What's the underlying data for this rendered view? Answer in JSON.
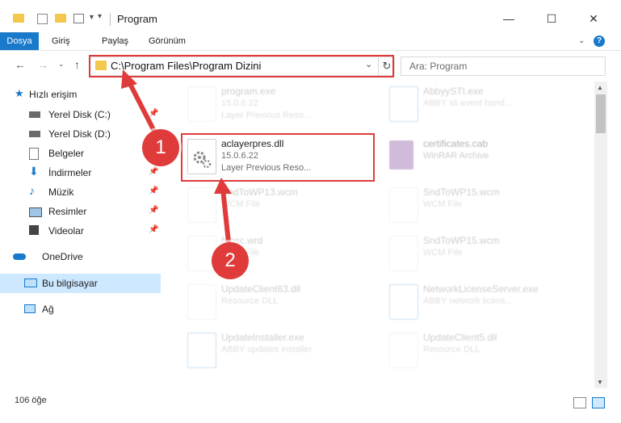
{
  "window": {
    "title": "Program"
  },
  "ribbon": {
    "tabs": [
      "Dosya",
      "Giriş",
      "Paylaş",
      "Görünüm"
    ],
    "help": "?"
  },
  "address": {
    "path": "C:\\Program Files\\Program Dizini"
  },
  "search": {
    "placeholder": "Ara: Program"
  },
  "sidebar": {
    "quick_access": "Hızlı erişim",
    "items": [
      "Yerel Disk (C:)",
      "Yerel Disk (D:)",
      "Belgeler",
      "İndirmeler",
      "Müzik",
      "Resimler",
      "Videolar"
    ],
    "onedrive": "OneDrive",
    "this_pc": "Bu bilgisayar",
    "network": "Ağ"
  },
  "files": [
    {
      "name": "program.exe",
      "meta1": "15.0.6.22",
      "meta2": "Layer Previous Reso..."
    },
    {
      "name": "AbbyySTI.exe",
      "meta1": "ABBY sti event hand...",
      "meta2": ""
    },
    {
      "name": "aclayerpres.dll",
      "meta1": "15.0.6.22",
      "meta2": "Layer Previous Reso..."
    },
    {
      "name": "certificates.cab",
      "meta1": "WinRAR Archive",
      "meta2": ""
    },
    {
      "name": "SndToWP13.wcm",
      "meta1": "WCM File",
      "meta2": ""
    },
    {
      "name": "SndToWP15.wcm",
      "meta1": "WCM File",
      "meta2": ""
    },
    {
      "name": "fabsc.wrd",
      "meta1": "WRD File",
      "meta2": ""
    },
    {
      "name": "SndToWP15.wcm",
      "meta1": "WCM File",
      "meta2": ""
    },
    {
      "name": "UpdateClient63.dll",
      "meta1": "Resource DLL",
      "meta2": ""
    },
    {
      "name": "NetworkLicenseServer.exe",
      "meta1": "ABBY network licens...",
      "meta2": ""
    },
    {
      "name": "UpdateInstaller.exe",
      "meta1": "ABBY updates installer",
      "meta2": ""
    },
    {
      "name": "UpdateClient5.dll",
      "meta1": "Resource DLL",
      "meta2": ""
    }
  ],
  "status": {
    "count": "106 öğe"
  },
  "callouts": [
    "1",
    "2"
  ],
  "colors": {
    "accent": "#1979ca",
    "highlight": "#e03b3b",
    "selected": "#cde8ff"
  }
}
